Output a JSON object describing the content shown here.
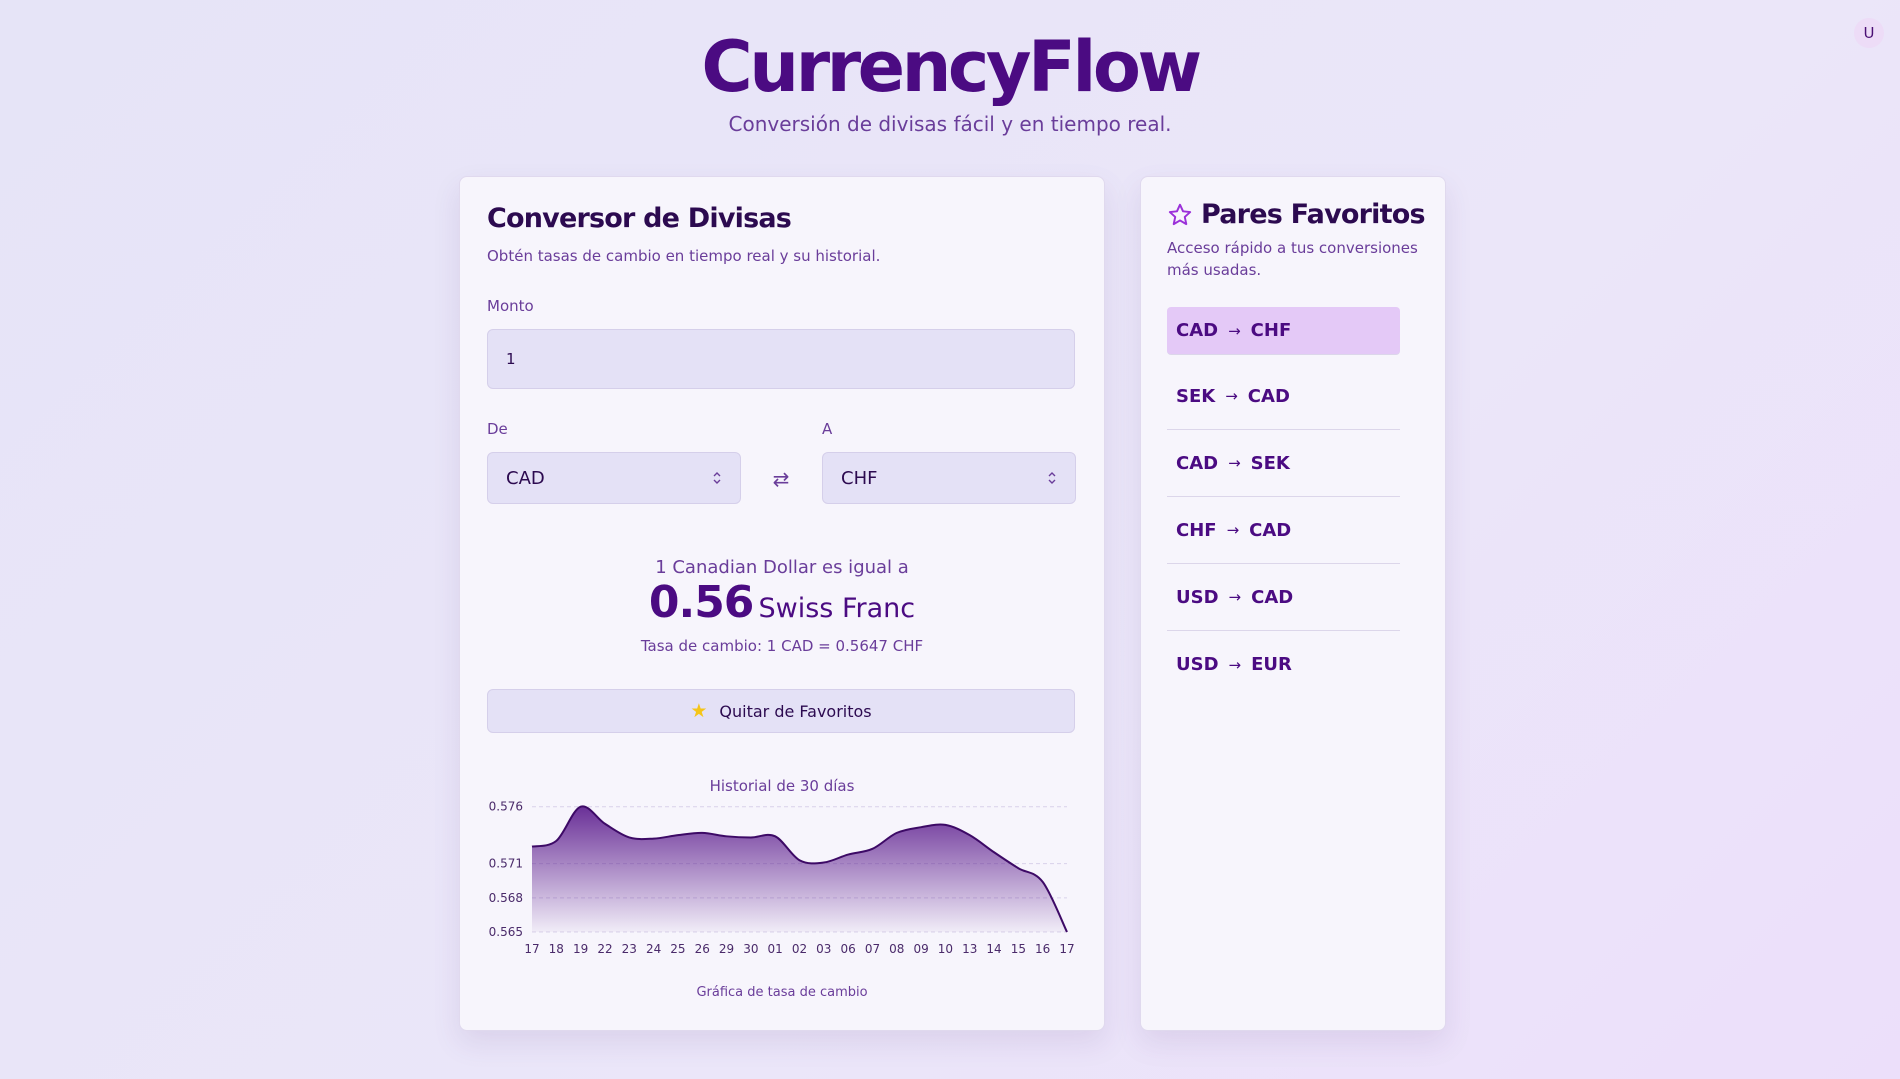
{
  "user": {
    "avatar_initial": "U"
  },
  "header": {
    "title": "CurrencyFlow",
    "subtitle": "Conversión de divisas fácil y en tiempo real."
  },
  "converter": {
    "title": "Conversor de Divisas",
    "description": "Obtén tasas de cambio en tiempo real y su historial.",
    "amount_label": "Monto",
    "amount_value": "1",
    "from_label": "De",
    "from_value": "CAD",
    "to_label": "A",
    "to_value": "CHF",
    "swap_icon": "⇄",
    "result_line": "1 Canadian Dollar es igual a",
    "result_value": "0.56",
    "result_unit": "Swiss Franc",
    "rate_line": "Tasa de cambio: 1 CAD = 0.5647 CHF",
    "favorite_button_label": "Quitar de Favoritos",
    "favorite_icon": "star-icon"
  },
  "chart_data": {
    "type": "area",
    "title": "Historial de 30 días",
    "caption": "Gráfica de tasa de cambio",
    "x": [
      "17",
      "18",
      "19",
      "22",
      "23",
      "24",
      "25",
      "26",
      "29",
      "30",
      "01",
      "02",
      "03",
      "06",
      "07",
      "08",
      "09",
      "10",
      "13",
      "14",
      "15",
      "16",
      "17"
    ],
    "values": [
      0.5725,
      0.573,
      0.576,
      0.5745,
      0.5733,
      0.5732,
      0.5735,
      0.5737,
      0.5734,
      0.5733,
      0.5734,
      0.5713,
      0.5711,
      0.5718,
      0.5723,
      0.5737,
      0.5742,
      0.5744,
      0.5735,
      0.572,
      0.5706,
      0.5694,
      0.565
    ],
    "y_ticks": [
      "0.576",
      "0.571",
      "0.568",
      "0.565"
    ],
    "ylim": [
      0.565,
      0.5765
    ],
    "grid": true,
    "color": "#5a1a8c"
  },
  "favorites": {
    "title": "Pares Favoritos",
    "icon": "star-outline-icon",
    "description": "Acceso rápido a tus conversiones más usadas.",
    "arrow": "→",
    "pairs": [
      {
        "from": "CAD",
        "to": "CHF"
      },
      {
        "from": "SEK",
        "to": "CAD"
      },
      {
        "from": "CAD",
        "to": "SEK"
      },
      {
        "from": "CHF",
        "to": "CAD"
      },
      {
        "from": "USD",
        "to": "CAD"
      },
      {
        "from": "USD",
        "to": "EUR"
      }
    ]
  }
}
